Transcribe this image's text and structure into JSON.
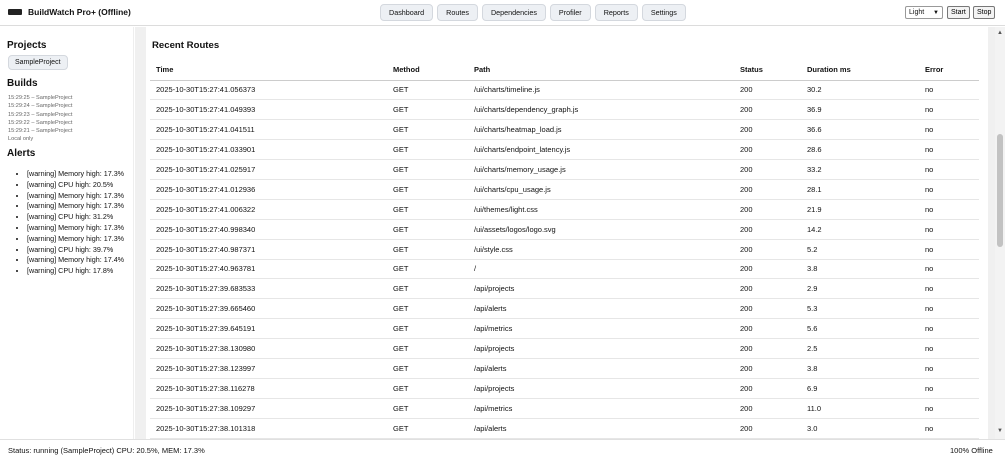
{
  "header": {
    "title": "BuildWatch Pro+ (Offline)",
    "nav": [
      "Dashboard",
      "Routes",
      "Dependencies",
      "Profiler",
      "Reports",
      "Settings"
    ],
    "theme_value": "Light",
    "start_label": "Start",
    "stop_label": "Stop"
  },
  "sidebar": {
    "projects_heading": "Projects",
    "project": "SampleProject",
    "builds_heading": "Builds",
    "builds": [
      "15:29:25 – SampleProject",
      "15:29:24 – SampleProject",
      "15:29:23 – SampleProject",
      "15:29:22 – SampleProject",
      "15:29:21 – SampleProject"
    ],
    "local_only": "Local only",
    "alerts_heading": "Alerts",
    "alerts": [
      "[warning] Memory high: 17.3%",
      "[warning] CPU high: 20.5%",
      "[warning] Memory high: 17.3%",
      "[warning] Memory high: 17.3%",
      "[warning] CPU high: 31.2%",
      "[warning] Memory high: 17.3%",
      "[warning] Memory high: 17.3%",
      "[warning] CPU high: 39.7%",
      "[warning] Memory high: 17.4%",
      "[warning] CPU high: 17.8%"
    ]
  },
  "main": {
    "section_title": "Recent Routes",
    "columns": [
      "Time",
      "Method",
      "Path",
      "Status",
      "Duration ms",
      "Error"
    ],
    "rows": [
      [
        "2025-10-30T15:27:41.056373",
        "GET",
        "/ui/charts/timeline.js",
        "200",
        "30.2",
        "no"
      ],
      [
        "2025-10-30T15:27:41.049393",
        "GET",
        "/ui/charts/dependency_graph.js",
        "200",
        "36.9",
        "no"
      ],
      [
        "2025-10-30T15:27:41.041511",
        "GET",
        "/ui/charts/heatmap_load.js",
        "200",
        "36.6",
        "no"
      ],
      [
        "2025-10-30T15:27:41.033901",
        "GET",
        "/ui/charts/endpoint_latency.js",
        "200",
        "28.6",
        "no"
      ],
      [
        "2025-10-30T15:27:41.025917",
        "GET",
        "/ui/charts/memory_usage.js",
        "200",
        "33.2",
        "no"
      ],
      [
        "2025-10-30T15:27:41.012936",
        "GET",
        "/ui/charts/cpu_usage.js",
        "200",
        "28.1",
        "no"
      ],
      [
        "2025-10-30T15:27:41.006322",
        "GET",
        "/ui/themes/light.css",
        "200",
        "21.9",
        "no"
      ],
      [
        "2025-10-30T15:27:40.998340",
        "GET",
        "/ui/assets/logos/logo.svg",
        "200",
        "14.2",
        "no"
      ],
      [
        "2025-10-30T15:27:40.987371",
        "GET",
        "/ui/style.css",
        "200",
        "5.2",
        "no"
      ],
      [
        "2025-10-30T15:27:40.963781",
        "GET",
        "/",
        "200",
        "3.8",
        "no"
      ],
      [
        "2025-10-30T15:27:39.683533",
        "GET",
        "/api/projects",
        "200",
        "2.9",
        "no"
      ],
      [
        "2025-10-30T15:27:39.665460",
        "GET",
        "/api/alerts",
        "200",
        "5.3",
        "no"
      ],
      [
        "2025-10-30T15:27:39.645191",
        "GET",
        "/api/metrics",
        "200",
        "5.6",
        "no"
      ],
      [
        "2025-10-30T15:27:38.130980",
        "GET",
        "/api/projects",
        "200",
        "2.5",
        "no"
      ],
      [
        "2025-10-30T15:27:38.123997",
        "GET",
        "/api/alerts",
        "200",
        "3.8",
        "no"
      ],
      [
        "2025-10-30T15:27:38.116278",
        "GET",
        "/api/projects",
        "200",
        "6.9",
        "no"
      ],
      [
        "2025-10-30T15:27:38.109297",
        "GET",
        "/api/metrics",
        "200",
        "11.0",
        "no"
      ],
      [
        "2025-10-30T15:27:38.101318",
        "GET",
        "/api/alerts",
        "200",
        "3.0",
        "no"
      ]
    ]
  },
  "status": {
    "left": "Status: running (SampleProject)   CPU: 20.5%, MEM: 17.3%",
    "right": "100% Offline"
  },
  "scrollbar": {
    "up_glyph": "▲",
    "down_glyph": "▼"
  }
}
